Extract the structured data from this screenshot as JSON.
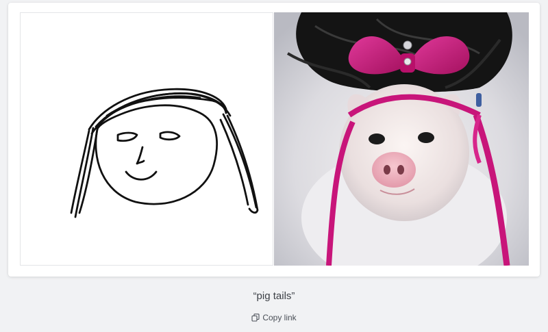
{
  "gallery_item": {
    "caption": "“pig tails”",
    "copy_link_label": "Copy link",
    "sketch_alt": "child's line drawing of a face with long hair",
    "result_alt": "generated image of a pig with pigtails and a pink bow",
    "colors": {
      "page_background": "#f1f2f4",
      "card_background": "#ffffff",
      "ink": "#111111",
      "ribbon": "#c8157a"
    }
  },
  "icons": {
    "copy": "copy-icon"
  }
}
